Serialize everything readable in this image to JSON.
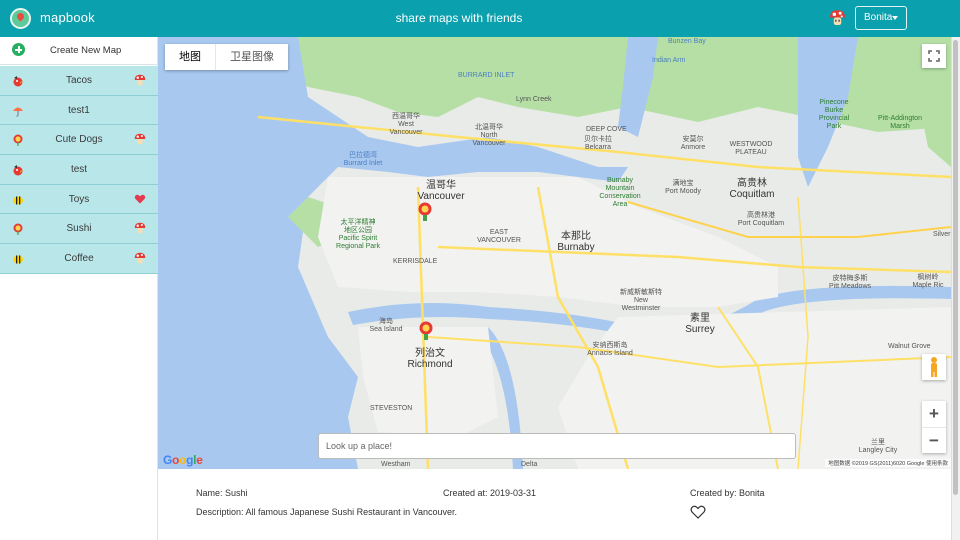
{
  "header": {
    "brand": "mapbook",
    "tagline": "share maps with friends",
    "user_button": "Bonita",
    "icons": [
      "map-pin-logo-icon",
      "mushroom-icon"
    ]
  },
  "sidebar": {
    "create_label": "Create New Map",
    "items": [
      {
        "label": "Tacos",
        "icon": "bird-icon",
        "status": "mushroom"
      },
      {
        "label": "test1",
        "icon": "umbrella-icon",
        "status": ""
      },
      {
        "label": "Cute Dogs",
        "icon": "flower-icon",
        "status": "mushroom"
      },
      {
        "label": "test",
        "icon": "bird-icon",
        "status": ""
      },
      {
        "label": "Toys",
        "icon": "bee-icon",
        "status": "heart"
      },
      {
        "label": "Sushi",
        "icon": "flower-icon",
        "status": "mushroom"
      },
      {
        "label": "Coffee",
        "icon": "bee-icon",
        "status": "mushroom"
      }
    ]
  },
  "map": {
    "tabs": [
      "地图",
      "卫星图像"
    ],
    "search_placeholder": "Look up a place!",
    "logo": "Google",
    "attribution": "地图数据 ©2019 GS(2011)6020 Google   使用条款",
    "labels": [
      {
        "text": "BURRARD INLET",
        "kind": "water"
      },
      {
        "text": "Lynn Creek",
        "kind": "normal"
      },
      {
        "text": "西温哥华\nWest\nVancouver",
        "kind": "normal"
      },
      {
        "text": "北温哥华\nNorth\nVancouver",
        "kind": "normal"
      },
      {
        "text": "巴拉德湾\nBurrard Inlet",
        "kind": "water"
      },
      {
        "text": "温哥华\nVancouver",
        "kind": "big"
      },
      {
        "text": "太平洋精神\n地区公园\nPacific Spirit\nRegional Park",
        "kind": "park"
      },
      {
        "text": "本那比\nBurnaby",
        "kind": "big"
      },
      {
        "text": "Burnaby\nMountain\nConservation\nArea",
        "kind": "park"
      },
      {
        "text": "满地宝\nPort Moody",
        "kind": "normal"
      },
      {
        "text": "高贵林\nCoquitlam",
        "kind": "big"
      },
      {
        "text": "高贵林港\nPort Coquitlam",
        "kind": "normal"
      },
      {
        "text": "新威斯敏斯特\nNew\nWestminster",
        "kind": "normal"
      },
      {
        "text": "海岛\nSea Island",
        "kind": "normal"
      },
      {
        "text": "列治文\nRichmond",
        "kind": "big"
      },
      {
        "text": "素里\nSurrey",
        "kind": "big"
      },
      {
        "text": "安纳西斯岛\nAnnacis Island",
        "kind": "normal"
      },
      {
        "text": "皮特梅多斯\nPitt Meadows",
        "kind": "normal"
      },
      {
        "text": "枫树岭\nMaple Ric",
        "kind": "normal"
      },
      {
        "text": "Pinecone\nBurke\nProvincial\nPark",
        "kind": "park"
      },
      {
        "text": "Pitt-Addington\nMarsh",
        "kind": "park"
      },
      {
        "text": "贝尔卡拉\nBelcarra",
        "kind": "normal"
      },
      {
        "text": "安莫尔\nAnmore",
        "kind": "normal"
      },
      {
        "text": "Walnut Grove",
        "kind": "normal"
      },
      {
        "text": "兰里\nLangley City",
        "kind": "normal"
      },
      {
        "text": "Bunzen Bay",
        "kind": "water"
      },
      {
        "text": "Indian Arm",
        "kind": "water"
      },
      {
        "text": "KERRISDALE",
        "kind": "normal"
      },
      {
        "text": "EAST\nVANCOUVER",
        "kind": "normal"
      },
      {
        "text": "STEVESTON",
        "kind": "normal"
      },
      {
        "text": "Delta",
        "kind": "normal"
      },
      {
        "text": "Westham",
        "kind": "normal"
      },
      {
        "text": "DEEP COVE",
        "kind": "normal"
      },
      {
        "text": "WESTWOOD\nPLATEAU",
        "kind": "normal"
      },
      {
        "text": "Silver",
        "kind": "normal"
      }
    ]
  },
  "details": {
    "name": "Name: Sushi",
    "created_at": "Created at: 2019-03-31",
    "created_by": "Created by: Bonita",
    "description": "Description: All famous Japanese Sushi Restaurant in Vancouver."
  },
  "colors": {
    "topbar": "#0aa0ad",
    "sidebar_item_bg": "#b9e6e9",
    "water": "#a8c8f0",
    "land": "#e8ebe8",
    "park": "#b5dfa5"
  }
}
